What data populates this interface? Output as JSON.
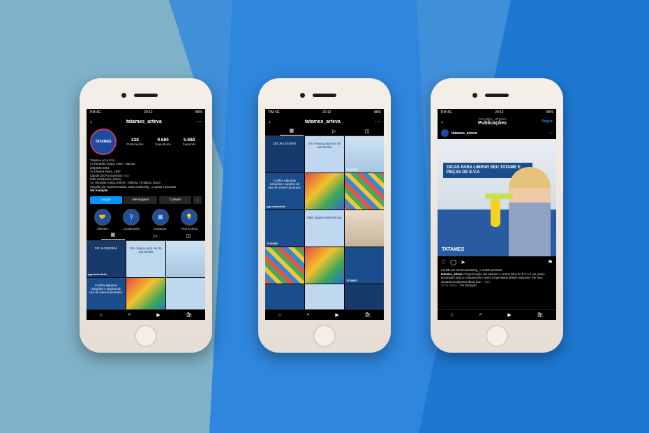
{
  "status": {
    "carrier": "TIM",
    "network": "4G",
    "time": "20:12",
    "battery": "86%"
  },
  "phone1": {
    "username": "tatames_arteva",
    "avatar_text": "TATAMES",
    "stats": [
      {
        "value": "238",
        "label": "Publicações"
      },
      {
        "value": "9.680",
        "label": "Seguidores"
      },
      {
        "value": "5.888",
        "label": "Seguindo"
      }
    ],
    "bio": {
      "name": "Tatames Art & EVA",
      "lines": [
        "Av Heráclito Graça, 1000 - Aldeota",
        "(85)3034-5081",
        "Av Oliveira Paiva, 1940",
        "Cidade dos Funcionários",
        "linktr.ee/tatames_arteva",
        "Av. Heráclito Graça,1000 B - Aldeota, Fortaleza, Brazil"
      ],
      "followed_by": "Seguido por waysnecessitat, smart.marketing_ e outras 4 pessoas",
      "translate": "Ver tradução",
      "more": "mais"
    },
    "buttons": {
      "follow": "Seguir",
      "message": "Mensagem",
      "contact": "Contato",
      "more": "⌄"
    },
    "highlights": [
      {
        "label": "Clientes",
        "icon": "handshake-icon"
      },
      {
        "label": "Localização",
        "icon": "location-icon"
      },
      {
        "label": "Espaços",
        "icon": "mat-icon"
      },
      {
        "label": "Fica a Dica!",
        "icon": "lightbulb-icon"
      }
    ],
    "grid": [
      {
        "style": "c-navy",
        "text": "DO JACKSONVI",
        "badge": "jogo amarelinha"
      },
      {
        "style": "c-light",
        "text": "Ele chegou para ser da sua família",
        "badge": ""
      },
      {
        "style": "c-dog",
        "text": "",
        "badge": ""
      },
      {
        "style": "c-blue",
        "text": "Confira algumas soluções e opções de uso de nossos produtos.",
        "badge": "jogo amarelinha"
      },
      {
        "style": "c-mix",
        "text": "",
        "badge": ""
      },
      {
        "style": "c-light",
        "text": "",
        "badge": "TATAMES"
      }
    ]
  },
  "phone2": {
    "username": "tatames_arteva",
    "grid": [
      {
        "style": "c-navy",
        "text": "DO JACKSONVI",
        "badge": ""
      },
      {
        "style": "c-light",
        "text": "Ele chegou para ser da sua família",
        "badge": ""
      },
      {
        "style": "c-dog",
        "text": "",
        "badge": "TATAMES"
      },
      {
        "style": "c-blue",
        "text": "Confira algumas soluções e opções de uso de nossos produtos.",
        "badge": "jogo amarelinha"
      },
      {
        "style": "c-mix",
        "text": "",
        "badge": ""
      },
      {
        "style": "c-mat",
        "text": "",
        "badge": ""
      },
      {
        "style": "c-blue",
        "text": "",
        "badge": "TATAMES"
      },
      {
        "style": "c-light",
        "text": "Mais lugares para brincar",
        "badge": ""
      },
      {
        "style": "c-girl",
        "text": "",
        "badge": ""
      },
      {
        "style": "c-mat",
        "text": "",
        "badge": ""
      },
      {
        "style": "c-mix",
        "text": "",
        "badge": ""
      },
      {
        "style": "c-blue",
        "text": "",
        "badge": "TATAMES"
      },
      {
        "style": "c-blue",
        "text": "",
        "badge": "TATAMES"
      },
      {
        "style": "c-light",
        "text": "",
        "badge": ""
      },
      {
        "style": "c-navy",
        "text": "",
        "badge": ""
      }
    ]
  },
  "phone3": {
    "subtitle": "TATAMES_ARTEVA",
    "title": "Publicações",
    "follow": "Seguir",
    "post_user": "tatames_arteva",
    "banner": "DICAS PARA LIMPAR SEU TATAME E PEÇAS DE E.V.A",
    "logo": "TATAMES",
    "liked_by": "Curtido por smart.marketing_ e outras pessoas",
    "caption_user": "tatames_arteva",
    "caption": "A higienização dos tatames e outros itens de E.V.A é um passo importante para a manutenção e maior longevidade destes materiais. Por isso, separamos algumas dicas que...",
    "caption_more": "mais",
    "date": "28 de março",
    "translate": "Ver tradução"
  }
}
